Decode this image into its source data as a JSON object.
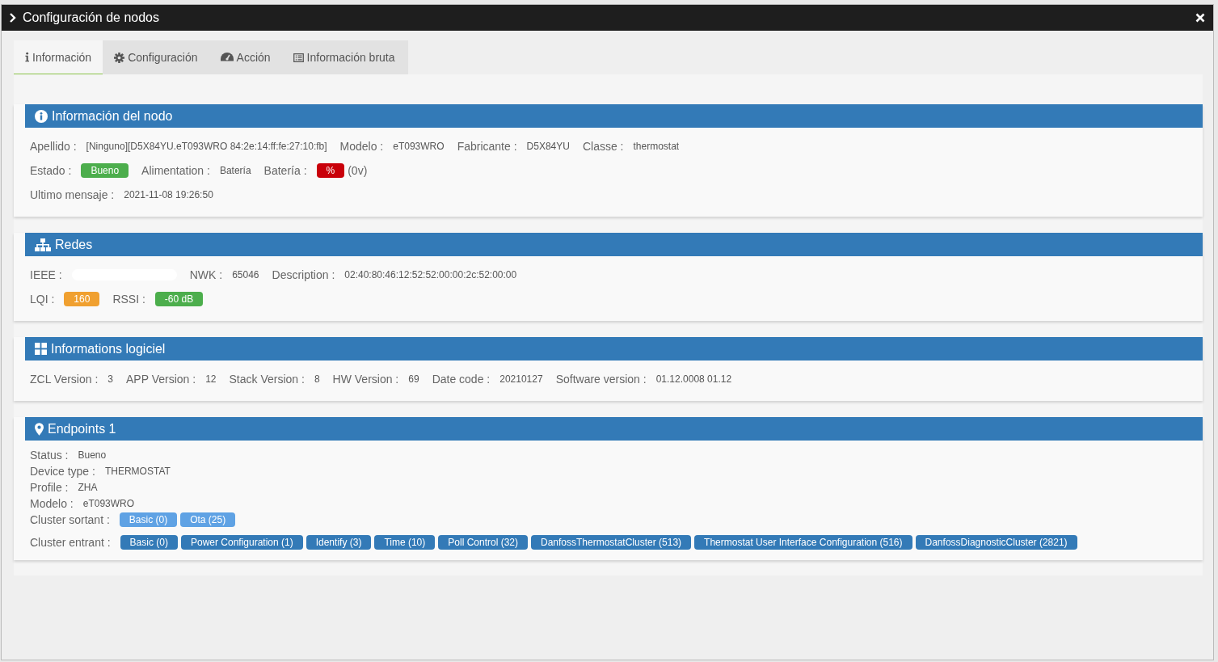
{
  "window": {
    "title": "Configuración de nodos"
  },
  "tabs": [
    {
      "label": "Información",
      "selected": true
    },
    {
      "label": "Configuración",
      "selected": false
    },
    {
      "label": "Acción",
      "selected": false
    },
    {
      "label": "Información bruta",
      "selected": false
    }
  ],
  "panels": [
    {
      "title": "Información del nodo",
      "lines": [
        {
          "fields": [
            {
              "label": "Apellido :",
              "value": "[Ninguno][D5X84YU.eT093WRO 84:2e:14:ff:fe:27:10:fb]"
            },
            {
              "label": "Modelo :",
              "value": "eT093WRO"
            },
            {
              "label": "Fabricante :",
              "value": "D5X84YU"
            },
            {
              "label": "Classe :",
              "value": "thermostat"
            }
          ]
        },
        {
          "fields": [
            {
              "label": "Estado :",
              "badge": "Bueno",
              "color": "#4cae4c"
            },
            {
              "label": "Alimentation :",
              "value": "Batería"
            },
            {
              "label": "Batería :",
              "badge": "%",
              "color": "#c9000a",
              "suffix": "(0v)"
            }
          ]
        },
        {
          "fields": [
            {
              "label": "Ultimo mensaje :",
              "value": "2021-11-08 19:26:50"
            }
          ]
        }
      ]
    },
    {
      "title": "Redes",
      "lines": [
        {
          "fields": [
            {
              "label": "IEEE :",
              "redacted": true
            },
            {
              "label": "NWK :",
              "value": "65046"
            },
            {
              "label": "Description :",
              "value": "02:40:80:46:12:52:52:00:00:2c:52:00:00"
            }
          ]
        },
        {
          "fields": [
            {
              "label": "LQI :",
              "badge": "160",
              "color": "#f0a030"
            },
            {
              "label": "RSSI :",
              "badge": "-60 dB",
              "color": "#4cae4c"
            }
          ]
        }
      ]
    },
    {
      "title": "Informations logiciel",
      "lines": [
        {
          "fields": [
            {
              "label": "ZCL Version :",
              "value": "3"
            },
            {
              "label": "APP Version :",
              "value": "12"
            },
            {
              "label": "Stack Version :",
              "value": "8"
            },
            {
              "label": "HW Version :",
              "value": "69"
            },
            {
              "label": "Date code :",
              "value": "20210127"
            },
            {
              "label": "Software version :",
              "value": "01.12.0008 01.12"
            }
          ]
        }
      ]
    },
    {
      "title": "Endpoints 1",
      "lines": [
        {
          "fields": [
            {
              "label": "Status :",
              "value": "Bueno"
            }
          ]
        },
        {
          "fields": [
            {
              "label": "Device type :",
              "value": "THERMOSTAT"
            }
          ]
        },
        {
          "fields": [
            {
              "label": "Profile :",
              "value": "ZHA"
            }
          ]
        },
        {
          "fields": [
            {
              "label": "Modelo :",
              "value": "eT093WRO"
            }
          ]
        },
        {
          "fields": [
            {
              "label": "Cluster sortant :",
              "tags": [
                "Basic (0)",
                "Ota (25)"
              ],
              "color": "#5fa2e4"
            }
          ]
        },
        {
          "fields": [
            {
              "label": "Cluster entrant :",
              "tags": [
                "Basic (0)",
                "Power Configuration (1)",
                "Identify (3)",
                "Time (10)",
                "Poll Control (32)",
                "DanfossThermostatCluster (513)",
                "Thermostat User Interface Configuration (516)",
                "DanfossDiagnosticCluster (2821)"
              ],
              "color": "#337ab7"
            }
          ]
        }
      ]
    }
  ]
}
